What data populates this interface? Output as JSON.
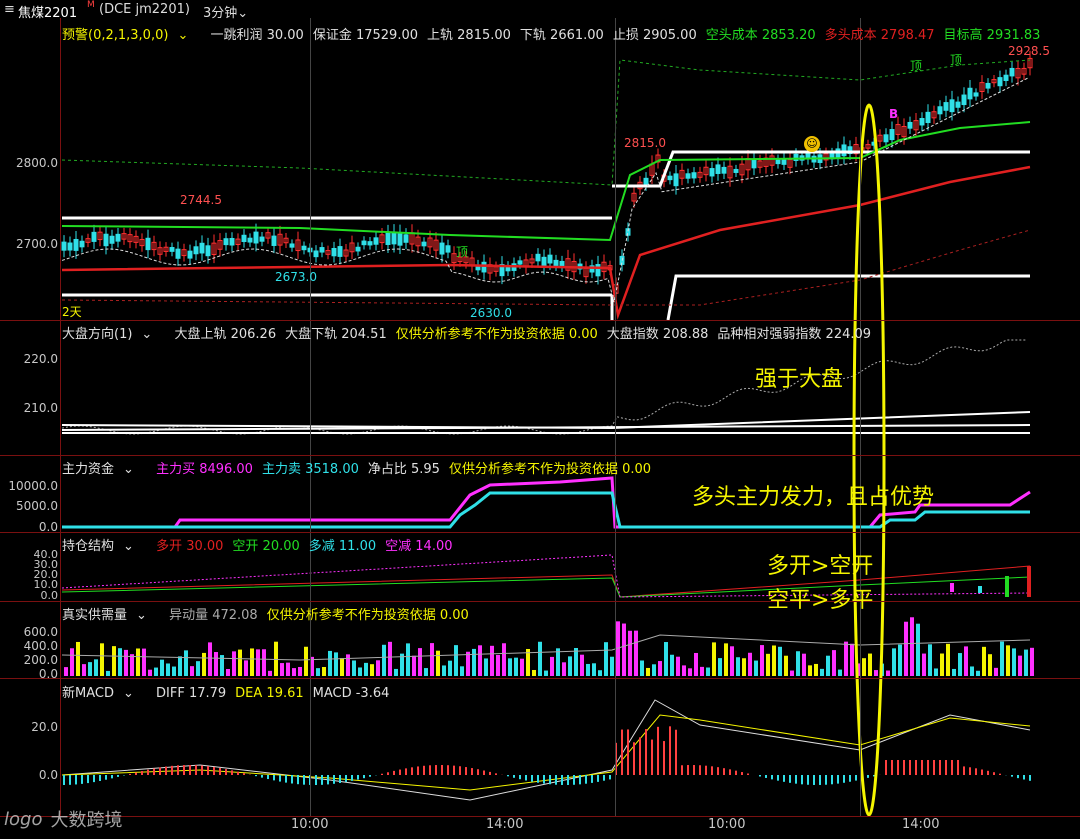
{
  "colors": {
    "white": "#ffffff",
    "green": "#22dd22",
    "red": "#e02020",
    "cyan": "#30e0e8",
    "magenta": "#ff30ff",
    "yellow": "#f5f500",
    "darkred": "#7a1010"
  },
  "topbar": {
    "symbol": "焦煤2201",
    "symbol_mark": "M",
    "contract": "(DCE jm2201)",
    "period": "3分钟",
    "period_icon": "chevron-down-icon"
  },
  "pane1": {
    "indicator": "预警(0,2,1,3,0,0)",
    "items": [
      {
        "label": "一跳利润",
        "value": "30.00",
        "color": "#e0e0e0"
      },
      {
        "label": "保证金",
        "value": "17529.00",
        "color": "#e0e0e0"
      },
      {
        "label": "上轨",
        "value": "2815.00",
        "color": "#e0e0e0"
      },
      {
        "label": "下轨",
        "value": "2661.00",
        "color": "#e0e0e0"
      },
      {
        "label": "止损",
        "value": "2905.00",
        "color": "#e0e0e0"
      },
      {
        "label": "空头成本",
        "value": "2853.20",
        "color": "#22dd22"
      },
      {
        "label": "多头成本",
        "value": "2798.47",
        "color": "#e02020"
      },
      {
        "label": "目标高",
        "value": "2931.83",
        "color": "#22dd22"
      }
    ],
    "axis": [
      "2800.0",
      "2700.0"
    ],
    "annotations": {
      "high1": "2744.5",
      "low1": "2673.0",
      "low2": "2630.0",
      "high2": "2815.0",
      "high3": "2928.5",
      "days": "2天",
      "top_marker": "顶",
      "b_marker": "B"
    }
  },
  "pane2": {
    "indicator": "大盘方向(1)",
    "items": [
      {
        "label": "大盘上轨",
        "value": "206.26",
        "color": "#e0e0e0"
      },
      {
        "label": "大盘下轨",
        "value": "204.51",
        "color": "#e0e0e0"
      },
      {
        "label": "仅供分析参考不作为投资依据",
        "value": "0.00",
        "color": "#f5f500"
      },
      {
        "label": "大盘指数",
        "value": "208.88",
        "color": "#e0e0e0"
      },
      {
        "label": "品种相对强弱指数",
        "value": "224.09",
        "color": "#e0e0e0"
      }
    ],
    "axis": [
      "220.0",
      "210.0"
    ]
  },
  "pane3": {
    "indicator": "主力资金",
    "items": [
      {
        "label": "主力买",
        "value": "8496.00",
        "color": "#ff30ff"
      },
      {
        "label": "主力卖",
        "value": "3518.00",
        "color": "#30e0e8"
      },
      {
        "label": "净占比",
        "value": "5.95",
        "color": "#e0e0e0"
      },
      {
        "label": "仅供分析参考不作为投资依据",
        "value": "0.00",
        "color": "#f5f500"
      }
    ],
    "axis": [
      "10000.0",
      "5000.0",
      "0.0"
    ]
  },
  "pane4": {
    "indicator": "持仓结构",
    "items": [
      {
        "label": "多开",
        "value": "30.00",
        "color": "#e02020"
      },
      {
        "label": "空开",
        "value": "20.00",
        "color": "#22dd22"
      },
      {
        "label": "多减",
        "value": "11.00",
        "color": "#30e0e8"
      },
      {
        "label": "空减",
        "value": "14.00",
        "color": "#ff30ff"
      }
    ],
    "axis": [
      "40.0",
      "30.0",
      "20.0",
      "10.0",
      "0.0"
    ]
  },
  "pane5": {
    "indicator": "真实供需量",
    "items": [
      {
        "label": "异动量",
        "value": "472.08",
        "color": "#aaaaaa"
      },
      {
        "label": "仅供分析参考不作为投资依据",
        "value": "0.00",
        "color": "#f5f500"
      }
    ],
    "axis": [
      "600.0",
      "400.0",
      "200.0",
      "0.0"
    ]
  },
  "pane6": {
    "indicator": "新MACD",
    "items": [
      {
        "label": "DIFF",
        "value": "17.79",
        "color": "#e0e0e0"
      },
      {
        "label": "DEA",
        "value": "19.61",
        "color": "#f5f500"
      },
      {
        "label": "MACD",
        "value": "-3.64",
        "color": "#e0e0e0"
      }
    ],
    "axis": [
      "20.0",
      "0.0"
    ]
  },
  "time_axis": [
    "10:00",
    "14:00",
    "10:00",
    "14:00"
  ],
  "annotations": {
    "stronger": "强于大盘",
    "bulls": "多头主力发力，且占优势",
    "line1": "多开>空开",
    "line2": "空平>多平"
  },
  "watermark": {
    "text": "大数跨境",
    "logo": "logo"
  }
}
